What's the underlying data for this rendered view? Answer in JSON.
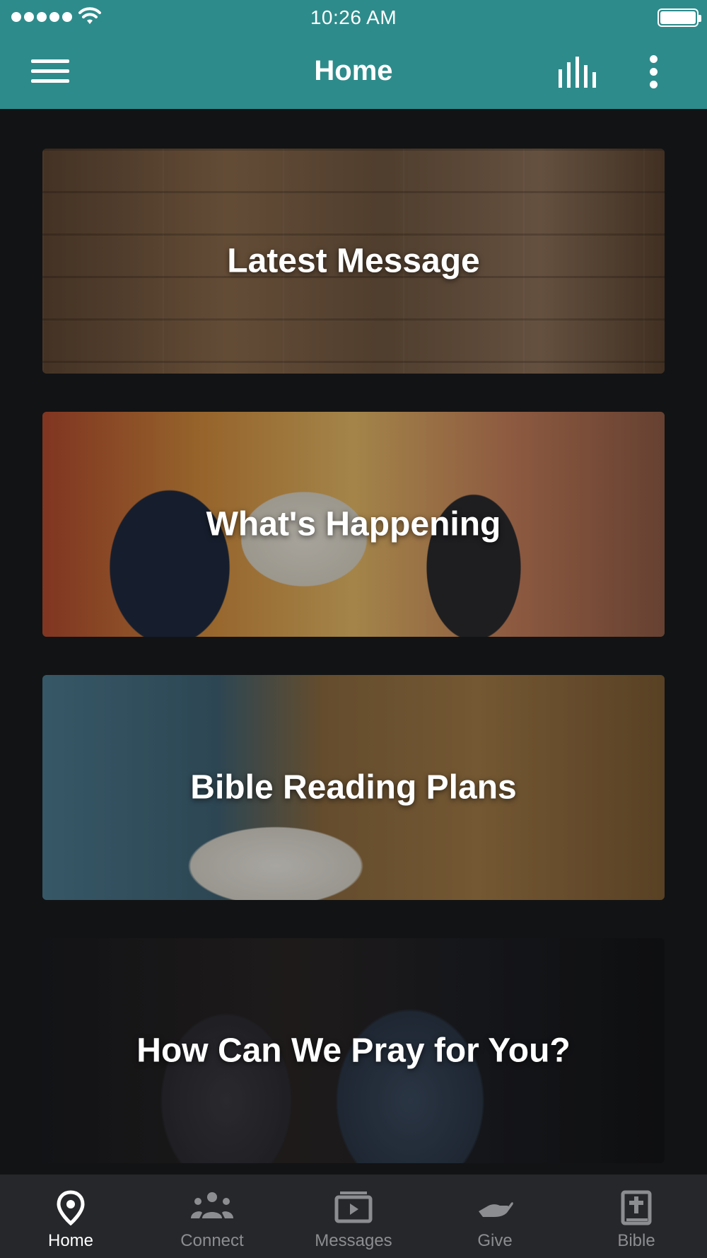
{
  "status_bar": {
    "time": "10:26 AM"
  },
  "header": {
    "title": "Home"
  },
  "cards": [
    {
      "label": "Latest Message"
    },
    {
      "label": "What's Happening"
    },
    {
      "label": "Bible Reading Plans"
    },
    {
      "label": "How Can We Pray for You?"
    }
  ],
  "bottom_nav": {
    "items": [
      {
        "label": "Home",
        "icon": "map-pin-icon",
        "active": true
      },
      {
        "label": "Connect",
        "icon": "group-icon",
        "active": false
      },
      {
        "label": "Messages",
        "icon": "video-play-icon",
        "active": false
      },
      {
        "label": "Give",
        "icon": "giving-hand-icon",
        "active": false
      },
      {
        "label": "Bible",
        "icon": "bible-book-icon",
        "active": false
      }
    ]
  },
  "colors": {
    "header_bg": "#2e8b8b",
    "page_bg": "#121315",
    "nav_bg": "#26272a",
    "nav_inactive": "#8c8d90",
    "nav_active": "#ffffff"
  }
}
